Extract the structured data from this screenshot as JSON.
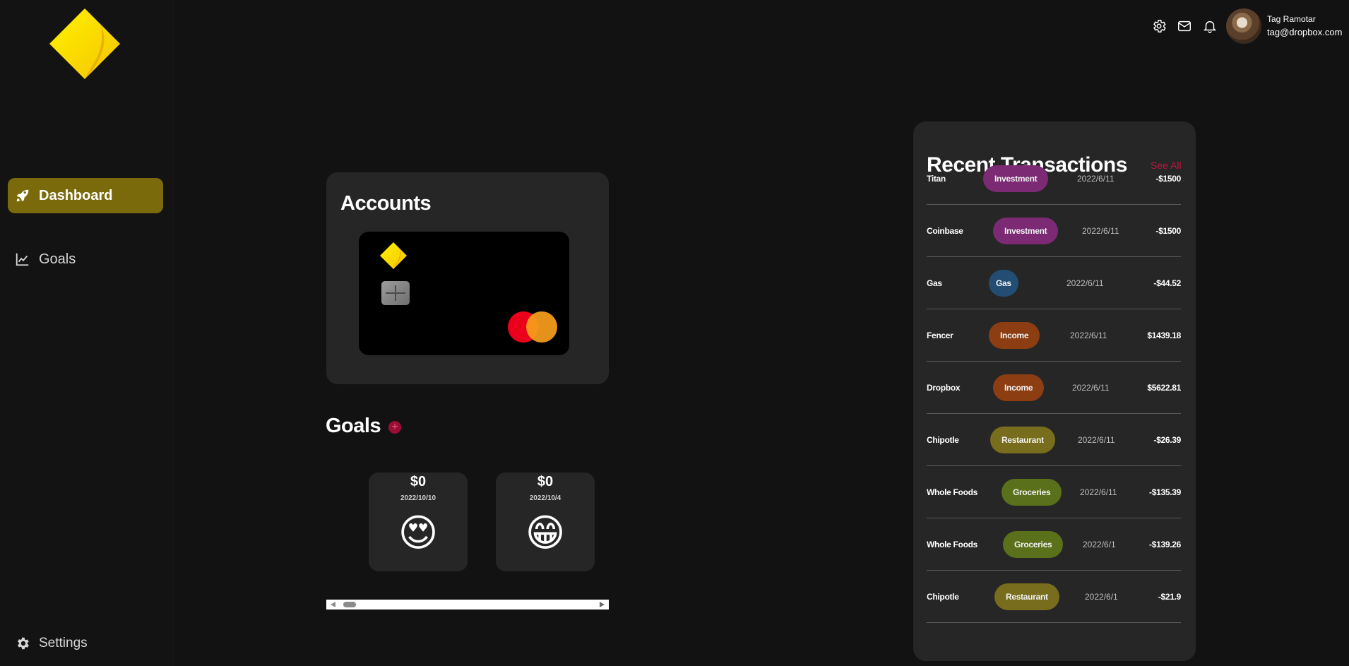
{
  "brand": {
    "accent": "#f2d90f",
    "accent_dark": "#7a6a0c",
    "danger": "#b8173f"
  },
  "sidebar": {
    "items": [
      {
        "label": "Dashboard",
        "icon": "rocket-icon",
        "active": true
      },
      {
        "label": "Goals",
        "icon": "chart-line-icon",
        "active": false
      }
    ],
    "settings_label": "Settings",
    "settings_icon": "gear-icon"
  },
  "topbar": {
    "icons": [
      "gear-icon",
      "mail-icon",
      "bell-icon"
    ],
    "user": {
      "name": "Tag Ramotar",
      "email": "tag@dropbox.com"
    }
  },
  "accounts": {
    "title": "Accounts",
    "card": {
      "network": "mastercard"
    }
  },
  "goals": {
    "title": "Goals",
    "add_label": "+",
    "items": [
      {
        "amount": "$0",
        "date": "2022/10/10",
        "emoji": "😍"
      },
      {
        "amount": "$0",
        "date": "2022/10/4",
        "emoji": "😁"
      }
    ]
  },
  "transactions": {
    "title": "Recent Transactions",
    "see_all": "See All",
    "items": [
      {
        "name": "Titan",
        "category": "Investment",
        "color": "#7b2a73",
        "date": "2022/6/11",
        "amount": "-$1500"
      },
      {
        "name": "Coinbase",
        "category": "Investment",
        "color": "#7b2a73",
        "date": "2022/6/11",
        "amount": "-$1500"
      },
      {
        "name": "Gas",
        "category": "Gas",
        "color": "#234d73",
        "date": "2022/6/11",
        "amount": "-$44.52"
      },
      {
        "name": "Fencer",
        "category": "Income",
        "color": "#8c3e12",
        "date": "2022/6/11",
        "amount": "$1439.18"
      },
      {
        "name": "Dropbox",
        "category": "Income",
        "color": "#8c3e12",
        "date": "2022/6/11",
        "amount": "$5622.81"
      },
      {
        "name": "Chipotle",
        "category": "Restaurant",
        "color": "#786d1c",
        "date": "2022/6/11",
        "amount": "-$26.39"
      },
      {
        "name": "Whole Foods",
        "category": "Groceries",
        "color": "#5a701a",
        "date": "2022/6/11",
        "amount": "-$135.39"
      },
      {
        "name": "Whole Foods",
        "category": "Groceries",
        "color": "#5a701a",
        "date": "2022/6/1",
        "amount": "-$139.26"
      },
      {
        "name": "Chipotle",
        "category": "Restaurant",
        "color": "#786d1c",
        "date": "2022/6/1",
        "amount": "-$21.9"
      }
    ]
  }
}
